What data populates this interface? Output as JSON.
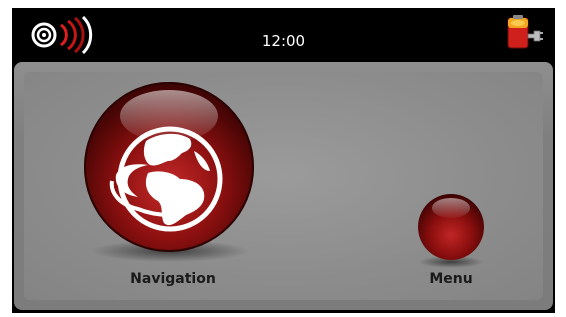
{
  "status_bar": {
    "time": "12:00",
    "gps_icon": "gps-signal-icon",
    "battery_icon": "battery-charging-icon"
  },
  "home": {
    "navigation_label": "Navigation",
    "navigation_icon": "globe-icon",
    "menu_label": "Menu"
  },
  "colors": {
    "accent": "#b01a1a",
    "background": "#8a8a8a",
    "bar": "#000000"
  }
}
